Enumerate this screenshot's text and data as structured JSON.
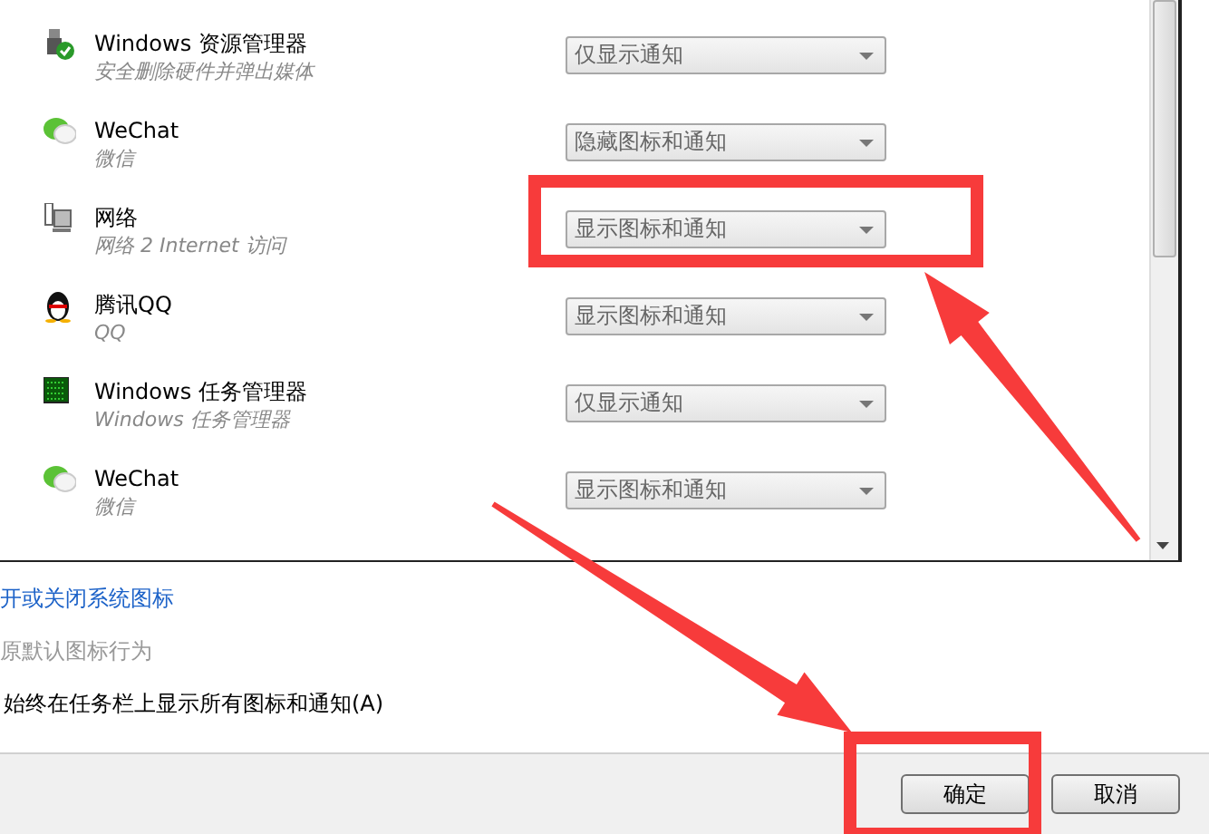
{
  "rows": [
    {
      "kind": "usb",
      "title": "Windows 资源管理器",
      "subtitle": "安全删除硬件并弹出媒体",
      "behavior": "仅显示通知"
    },
    {
      "kind": "chat",
      "title": "WeChat",
      "subtitle": "微信",
      "behavior": "隐藏图标和通知"
    },
    {
      "kind": "network",
      "title": "网络",
      "subtitle": "网络 2 Internet 访问",
      "behavior": "显示图标和通知"
    },
    {
      "kind": "penguin",
      "title": "腾讯QQ",
      "subtitle": "QQ",
      "behavior": "显示图标和通知"
    },
    {
      "kind": "monitor",
      "title": "Windows 任务管理器",
      "subtitle": "Windows 任务管理器",
      "behavior": "仅显示通知"
    },
    {
      "kind": "chat",
      "title": "WeChat",
      "subtitle": "微信",
      "behavior": "显示图标和通知"
    }
  ],
  "links": [
    {
      "text": "开或关闭系统图标",
      "disabled": false
    },
    {
      "text": "原默认图标行为",
      "disabled": true
    }
  ],
  "checkbox_label": "始终在任务栏上显示所有图标和通知(A)",
  "buttons": [
    "确定",
    "取消"
  ],
  "annotations": [
    {
      "kind": "box"
    },
    {
      "kind": "arrow"
    },
    {
      "kind": "arrow"
    },
    {
      "kind": "box"
    }
  ]
}
